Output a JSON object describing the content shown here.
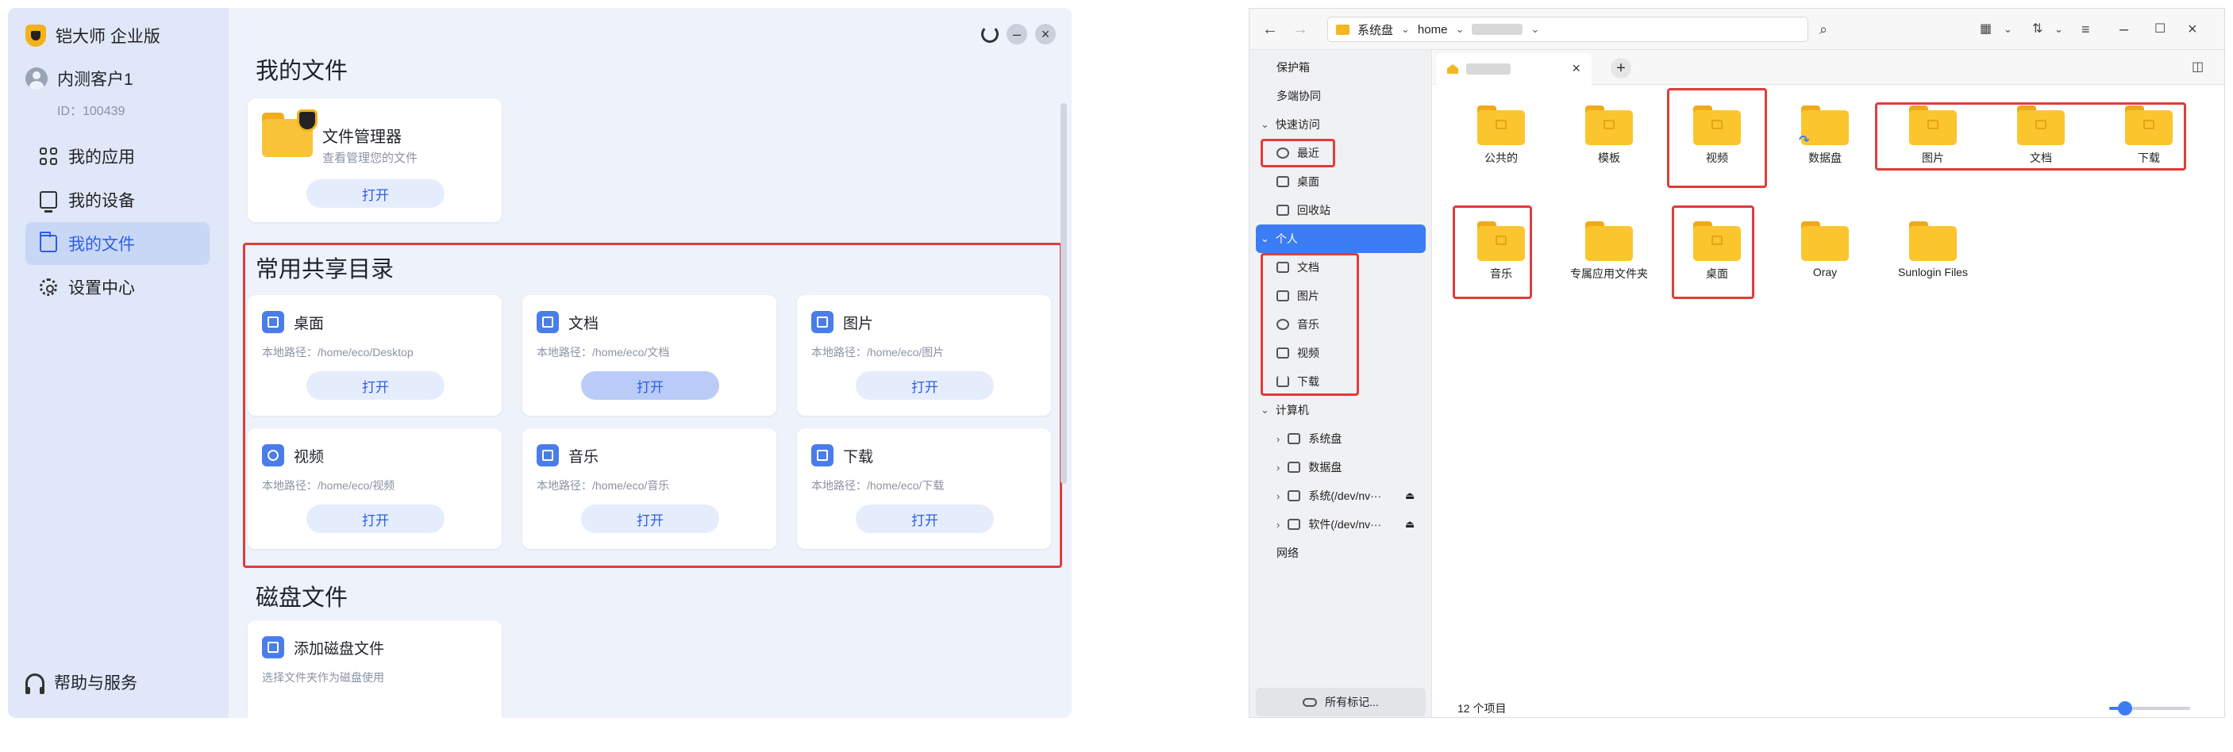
{
  "left_app": {
    "brand": "铠大师 企业版",
    "user": {
      "name": "内测客户1",
      "id": "ID：100439"
    },
    "nav": [
      {
        "label": "我的应用",
        "icon": "apps-icon"
      },
      {
        "label": "我的设备",
        "icon": "device-icon"
      },
      {
        "label": "我的文件",
        "icon": "folder-icon",
        "active": true
      },
      {
        "label": "设置中心",
        "icon": "gear-icon"
      }
    ],
    "help": "帮助与服务",
    "my_files_title": "我的文件",
    "file_manager": {
      "title": "文件管理器",
      "subtitle": "查看管理您的文件",
      "button": "打开"
    },
    "shared_title": "常用共享目录",
    "shared": [
      {
        "name": "桌面",
        "path": "本地路径：/home/eco/Desktop",
        "button": "打开",
        "icon": "desktop-icon"
      },
      {
        "name": "文档",
        "path": "本地路径：/home/eco/文档",
        "button": "打开",
        "icon": "document-icon"
      },
      {
        "name": "图片",
        "path": "本地路径：/home/eco/图片",
        "button": "打开",
        "icon": "image-icon"
      },
      {
        "name": "视频",
        "path": "本地路径：/home/eco/视频",
        "button": "打开",
        "icon": "video-icon"
      },
      {
        "name": "音乐",
        "path": "本地路径：/home/eco/音乐",
        "button": "打开",
        "icon": "music-icon"
      },
      {
        "name": "下载",
        "path": "本地路径：/home/eco/下载",
        "button": "打开",
        "icon": "download-icon"
      }
    ],
    "disk_title": "磁盘文件",
    "disk_card": {
      "title": "添加磁盘文件",
      "subtitle": "选择文件夹作为磁盘使用"
    },
    "accent": "#2d5ee8",
    "highlight": "#e23b3b"
  },
  "file_manager_window": {
    "address": {
      "root": "系统盘",
      "seg": "home"
    },
    "sidebar": [
      {
        "label": "保护箱",
        "kind": "plain"
      },
      {
        "label": "多端协同",
        "kind": "plain"
      },
      {
        "label": "快速访问",
        "kind": "group"
      },
      {
        "label": "最近",
        "kind": "item",
        "icon": "clock-icon"
      },
      {
        "label": "桌面",
        "kind": "item",
        "icon": "monitor-icon"
      },
      {
        "label": "回收站",
        "kind": "item",
        "icon": "trash-icon"
      },
      {
        "label": "个人",
        "kind": "group",
        "selected": true
      },
      {
        "label": "文档",
        "kind": "item",
        "icon": "document-icon"
      },
      {
        "label": "图片",
        "kind": "item",
        "icon": "image-icon"
      },
      {
        "label": "音乐",
        "kind": "item",
        "icon": "music-icon"
      },
      {
        "label": "视频",
        "kind": "item",
        "icon": "video-icon"
      },
      {
        "label": "下载",
        "kind": "item",
        "icon": "download-icon"
      },
      {
        "label": "计算机",
        "kind": "group"
      },
      {
        "label": "系统盘",
        "kind": "sub",
        "icon": "disk-icon"
      },
      {
        "label": "数据盘",
        "kind": "sub",
        "icon": "disk-icon"
      },
      {
        "label": "系统(/dev/nv···",
        "kind": "sub",
        "icon": "disk-icon",
        "eject": true
      },
      {
        "label": "软件(/dev/nv···",
        "kind": "sub",
        "icon": "disk-icon",
        "eject": true
      },
      {
        "label": "网络",
        "kind": "plain"
      }
    ],
    "all_tags": "所有标记...",
    "folders": [
      {
        "label": "公共的",
        "icon": "share-folder-icon"
      },
      {
        "label": "模板",
        "icon": "template-folder-icon"
      },
      {
        "label": "视频",
        "icon": "video-folder-icon"
      },
      {
        "label": "数据盘",
        "icon": "link-folder-icon"
      },
      {
        "label": "图片",
        "icon": "image-folder-icon"
      },
      {
        "label": "文档",
        "icon": "document-folder-icon"
      },
      {
        "label": "下载",
        "icon": "download-folder-icon"
      },
      {
        "label": "音乐",
        "icon": "music-folder-icon"
      },
      {
        "label": "专属应用文件夹",
        "icon": "folder-icon"
      },
      {
        "label": "桌面",
        "icon": "desktop-folder-icon"
      },
      {
        "label": "Oray",
        "icon": "folder-icon"
      },
      {
        "label": "Sunlogin Files",
        "icon": "folder-icon"
      }
    ],
    "status": "12 个项目",
    "zoom_level": 0.2,
    "accent": "#3d7df3"
  }
}
